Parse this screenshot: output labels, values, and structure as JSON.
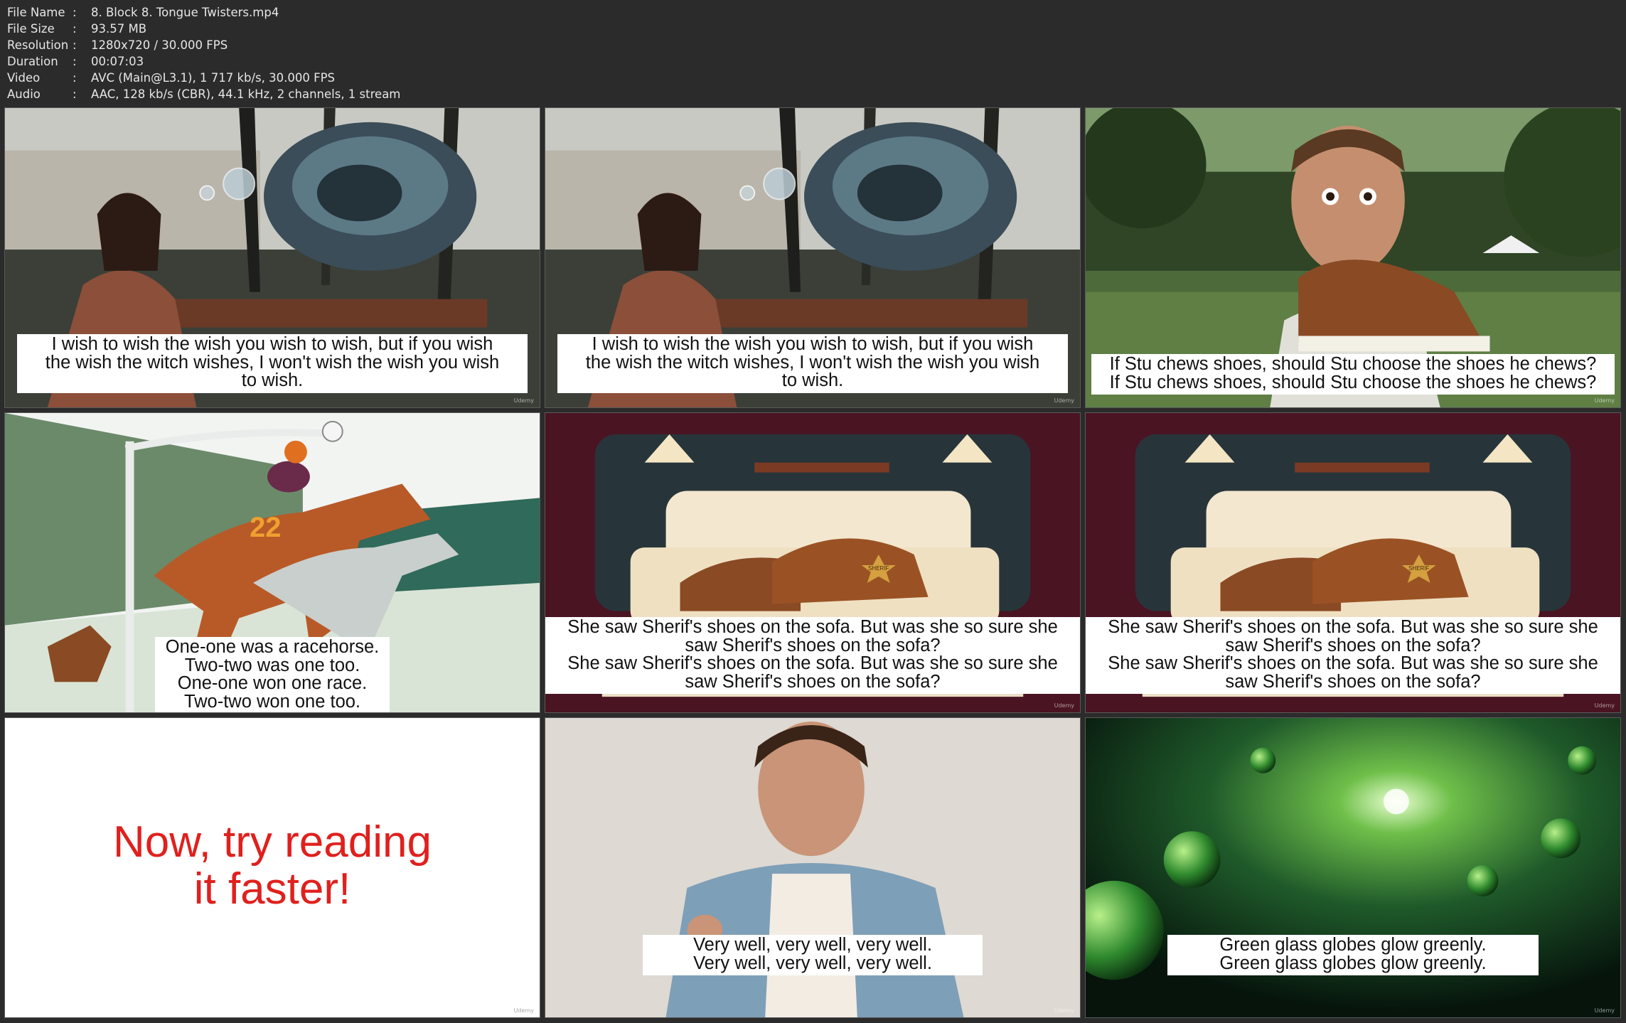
{
  "metadata": [
    {
      "key": "File Name",
      "value": "8. Block 8. Tongue Twisters.mp4"
    },
    {
      "key": "File Size",
      "value": "93.57 MB"
    },
    {
      "key": "Resolution",
      "value": "1280x720 / 30.000 FPS"
    },
    {
      "key": "Duration",
      "value": "00:07:03"
    },
    {
      "key": "Video",
      "value": "AVC (Main@L3.1), 1 717 kb/s, 30.000 FPS"
    },
    {
      "key": "Audio",
      "value": "AAC, 128 kb/s (CBR), 44.1 kHz, 2 channels, 1 stream"
    }
  ],
  "thumbnails": [
    {
      "caption": "I wish to wish the wish you wish to wish, but if you wish\nthe wish the witch wishes, I won't wish the wish you wish\nto wish.",
      "watermark": "Udemy"
    },
    {
      "caption": "I wish to wish the wish you wish to wish, but if you wish\nthe wish the witch wishes, I won't wish the wish you wish\nto wish.",
      "watermark": "Udemy"
    },
    {
      "caption": "If Stu chews shoes, should Stu choose the shoes he chews?\nIf Stu chews shoes, should Stu choose the shoes he chews?",
      "watermark": "Udemy"
    },
    {
      "caption": "One-one was a racehorse.\nTwo-two was one too.\nOne-one won one race.\nTwo-two won one too.",
      "jersey": "22",
      "watermark": ""
    },
    {
      "caption": "She saw Sherif's shoes on the sofa. But was she so sure she\nsaw Sherif's shoes on the sofa?\nShe saw Sherif's shoes on the sofa. But was she so sure she\nsaw Sherif's shoes on the sofa?",
      "badge": "SHERIF",
      "watermark": "Udemy"
    },
    {
      "caption": "She saw Sherif's shoes on the sofa. But was she so sure she\nsaw Sherif's shoes on the sofa?\nShe saw Sherif's shoes on the sofa. But was she so sure she\nsaw Sherif's shoes on the sofa?",
      "badge": "SHERIF",
      "watermark": "Udemy"
    },
    {
      "title": "Now, try reading\nit faster!",
      "watermark": "Udemy"
    },
    {
      "caption": "Very well, very well, very well.\nVery well, very well, very well.",
      "watermark": "Udemy"
    },
    {
      "caption": "Green glass globes glow greenly.\nGreen glass globes glow greenly.",
      "watermark": "Udemy"
    }
  ]
}
